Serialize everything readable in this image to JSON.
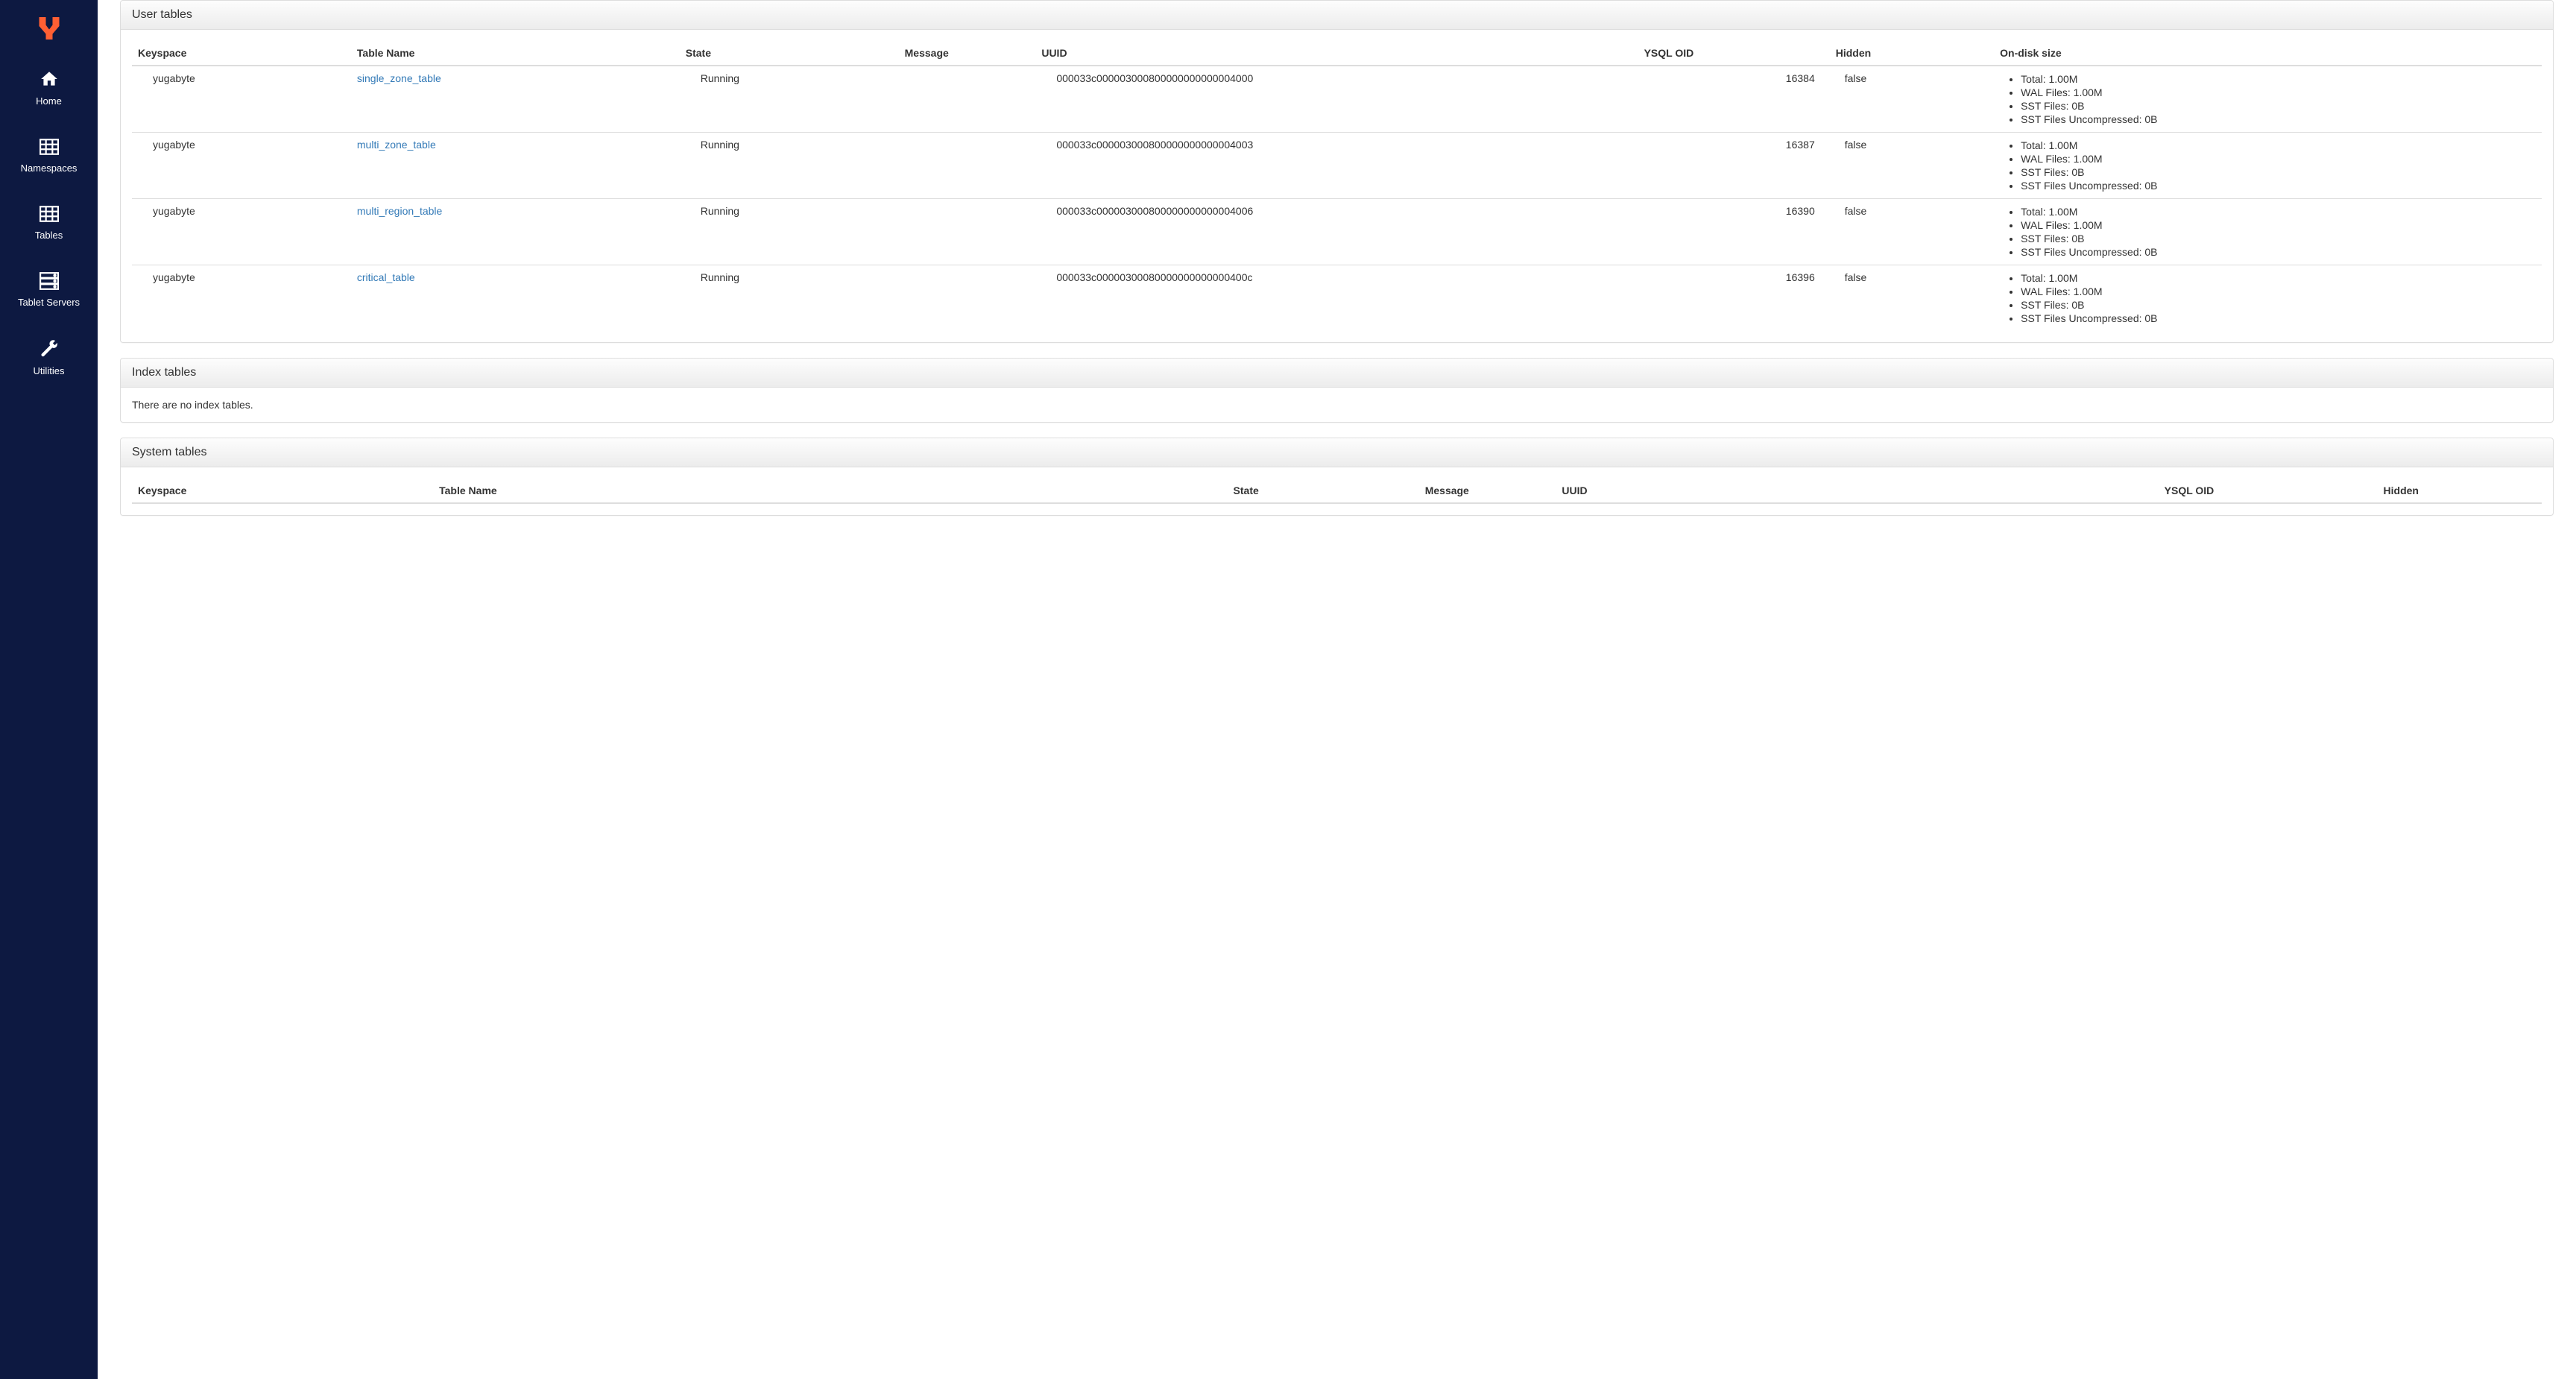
{
  "sidebar": {
    "items": [
      {
        "label": "Home"
      },
      {
        "label": "Namespaces"
      },
      {
        "label": "Tables"
      },
      {
        "label": "Tablet Servers"
      },
      {
        "label": "Utilities"
      }
    ]
  },
  "panels": {
    "user_tables": {
      "title": "User tables",
      "columns": {
        "keyspace": "Keyspace",
        "table_name": "Table Name",
        "state": "State",
        "message": "Message",
        "uuid": "UUID",
        "ysql_oid": "YSQL OID",
        "hidden": "Hidden",
        "on_disk_size": "On-disk size"
      },
      "rows": [
        {
          "keyspace": "yugabyte",
          "table_name": "single_zone_table",
          "state": "Running",
          "message": "",
          "uuid": "000033c000003000800000000000004000",
          "ysql_oid": "16384",
          "hidden": "false",
          "size": {
            "total": "Total: 1.00M",
            "wal": "WAL Files: 1.00M",
            "sst": "SST Files: 0B",
            "sst_uncompressed": "SST Files Uncompressed: 0B"
          }
        },
        {
          "keyspace": "yugabyte",
          "table_name": "multi_zone_table",
          "state": "Running",
          "message": "",
          "uuid": "000033c000003000800000000000004003",
          "ysql_oid": "16387",
          "hidden": "false",
          "size": {
            "total": "Total: 1.00M",
            "wal": "WAL Files: 1.00M",
            "sst": "SST Files: 0B",
            "sst_uncompressed": "SST Files Uncompressed: 0B"
          }
        },
        {
          "keyspace": "yugabyte",
          "table_name": "multi_region_table",
          "state": "Running",
          "message": "",
          "uuid": "000033c000003000800000000000004006",
          "ysql_oid": "16390",
          "hidden": "false",
          "size": {
            "total": "Total: 1.00M",
            "wal": "WAL Files: 1.00M",
            "sst": "SST Files: 0B",
            "sst_uncompressed": "SST Files Uncompressed: 0B"
          }
        },
        {
          "keyspace": "yugabyte",
          "table_name": "critical_table",
          "state": "Running",
          "message": "",
          "uuid": "000033c00000300080000000000000400c",
          "ysql_oid": "16396",
          "hidden": "false",
          "size": {
            "total": "Total: 1.00M",
            "wal": "WAL Files: 1.00M",
            "sst": "SST Files: 0B",
            "sst_uncompressed": "SST Files Uncompressed: 0B"
          }
        }
      ]
    },
    "index_tables": {
      "title": "Index tables",
      "empty_message": "There are no index tables."
    },
    "system_tables": {
      "title": "System tables",
      "columns": {
        "keyspace": "Keyspace",
        "table_name": "Table Name",
        "state": "State",
        "message": "Message",
        "uuid": "UUID",
        "ysql_oid": "YSQL OID",
        "hidden": "Hidden"
      }
    }
  }
}
